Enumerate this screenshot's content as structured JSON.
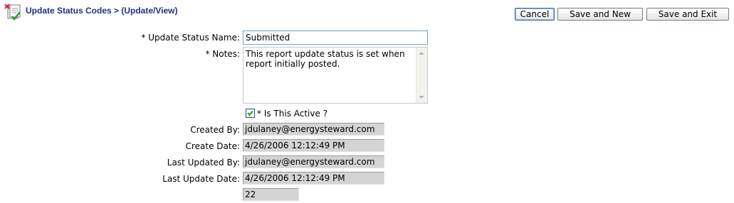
{
  "header": {
    "title": "Update Status Codes > (Update/View)"
  },
  "toolbar": {
    "cancel_label": "Cancel",
    "save_new_label": "Save and New",
    "save_exit_label": "Save and Exit"
  },
  "form": {
    "status_name": {
      "label": "* Update Status Name:",
      "value": "Submitted"
    },
    "notes": {
      "label": "* Notes:",
      "value": "This report update status is set when report initially posted."
    },
    "is_active": {
      "label": "* Is This Active ?",
      "checked": true
    },
    "created_by": {
      "label": "Created By:",
      "value": "jdulaney@energysteward.com"
    },
    "create_date": {
      "label": "Create Date:",
      "value": "4/26/2006 12:12:49 PM"
    },
    "last_updated_by": {
      "label": "Last Updated By:",
      "value": "jdulaney@energysteward.com"
    },
    "last_update_date": {
      "label": "Last Update Date:",
      "value": "4/26/2006 12:12:49 PM"
    },
    "id_value": "22"
  },
  "icons": {
    "header_icon": "document-edit-icon",
    "checkbox_mark": "checkmark-icon"
  },
  "colors": {
    "title": "#1f2f80",
    "readonly_bg": "#d4d4d4",
    "input_border": "#7f9db9"
  }
}
